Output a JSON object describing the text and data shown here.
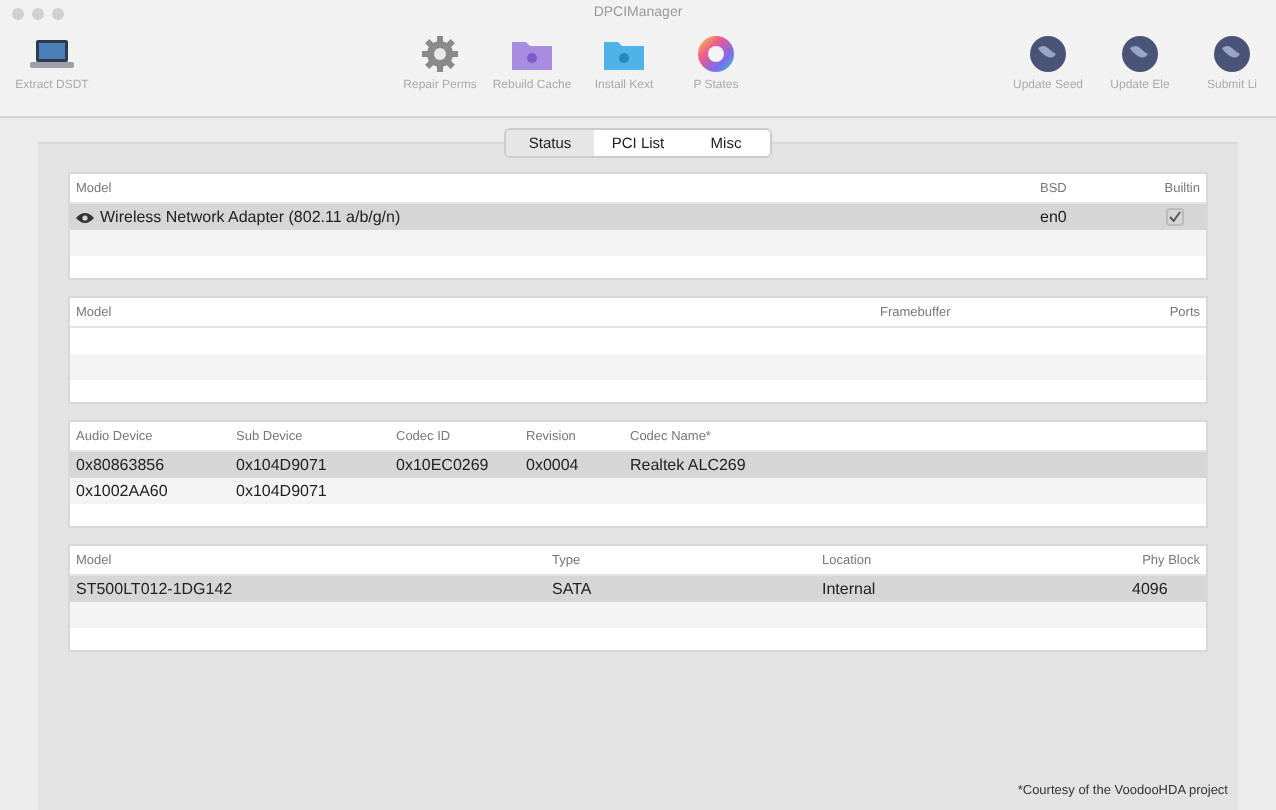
{
  "window": {
    "title": "DPCIManager"
  },
  "toolbar": {
    "left": [
      {
        "label": "Extract DSDT",
        "kind": "laptop"
      }
    ],
    "center": [
      {
        "label": "Repair Perms",
        "kind": "gear"
      },
      {
        "label": "Rebuild Cache",
        "kind": "folder"
      },
      {
        "label": "Install Kext",
        "kind": "bluefolder"
      },
      {
        "label": "P States",
        "kind": "wheel"
      }
    ],
    "right": [
      {
        "label": "Update Seed",
        "kind": "globe"
      },
      {
        "label": "Update Ele",
        "kind": "globe"
      },
      {
        "label": "Submit Li",
        "kind": "globe"
      }
    ]
  },
  "tabs": [
    {
      "label": "Status",
      "selected": true
    },
    {
      "label": "PCI List",
      "selected": false
    },
    {
      "label": "Misc",
      "selected": false
    }
  ],
  "tables": [
    {
      "columns": [
        "Model",
        "BSD",
        "Builtin"
      ],
      "rows": [
        {
          "selected": true,
          "cells": [
            "Wireless Network Adapter (802.11 a/b/g/n)",
            "en0"
          ],
          "checked": true
        }
      ]
    },
    {
      "columns": [
        "Model",
        "Framebuffer",
        "Ports"
      ]
    },
    {
      "columns": [
        "Audio Device",
        "Sub Device",
        "Codec ID",
        "Revision",
        "Codec Name*"
      ],
      "rows": [
        {
          "selected": true,
          "cells": [
            "0x80863856",
            "0x104D9071",
            "0x10EC0269",
            "0x0004",
            "Realtek ALC269"
          ]
        },
        {
          "selected": false,
          "cells": [
            "0x1002AA60",
            "0x104D9071"
          ]
        }
      ]
    },
    {
      "columns": [
        "Model",
        "Type",
        "Location",
        "Phy Block"
      ],
      "rows": [
        {
          "selected": true,
          "cells": [
            "ST500LT012-1DG142",
            "SATA",
            "Internal",
            "4096"
          ]
        }
      ]
    }
  ],
  "footnote": "*Courtesy of the VoodooHDA project"
}
